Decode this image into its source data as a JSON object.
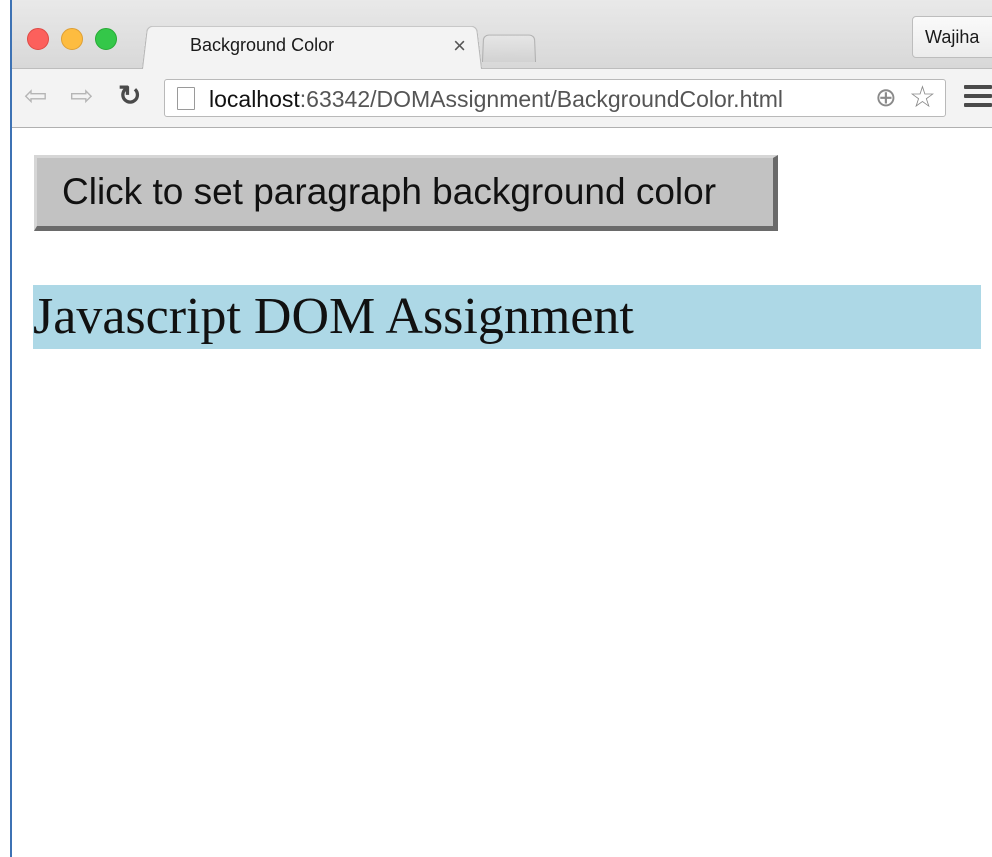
{
  "browser": {
    "tab_title": "Background Color",
    "tab_close": "×",
    "profile_name": "Wajiha",
    "url_host": "localhost",
    "url_rest": ":63342/DOMAssignment/BackgroundColor.html"
  },
  "icons": {
    "back": "arrow-left-icon",
    "forward": "arrow-right-icon",
    "reload": "reload-icon",
    "page": "page-icon",
    "zoom": "zoom-icon",
    "bookmark": "star-icon",
    "menu": "hamburger-menu-icon"
  },
  "page": {
    "button_label": "Click to set paragraph background color",
    "paragraph_text": "Javascript DOM Assignment",
    "paragraph_bg": "#add8e6"
  }
}
